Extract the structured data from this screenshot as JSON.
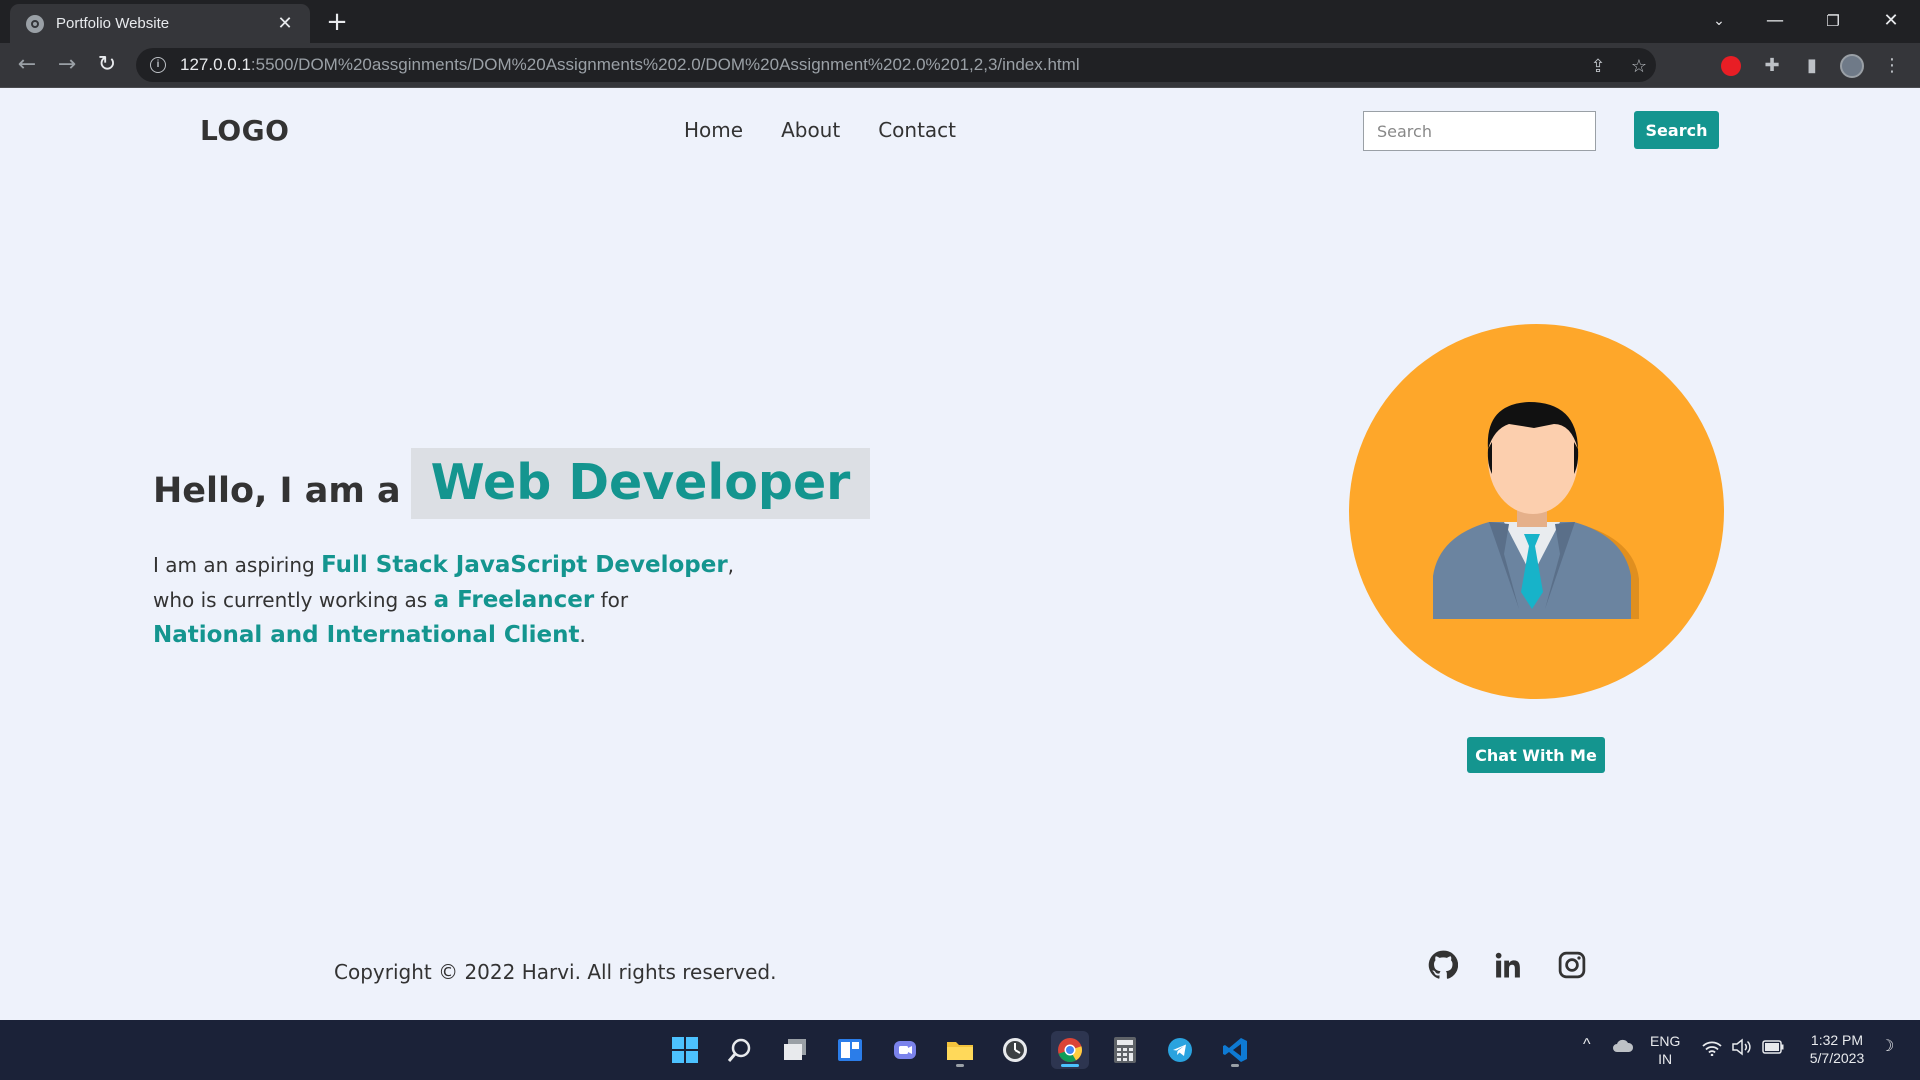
{
  "browser": {
    "tab_title": "Portfolio Website",
    "url_host": "127.0.0.1",
    "url_rest": ":5500/DOM%20assginments/DOM%20Assignments%202.0/DOM%20Assignment%202.0%201,2,3/index.html"
  },
  "header": {
    "logo": "LOGO",
    "nav": [
      {
        "label": "Home"
      },
      {
        "label": "About"
      },
      {
        "label": "Contact"
      }
    ],
    "search_placeholder": "Search",
    "search_button": "Search"
  },
  "hero": {
    "greeting": "Hello, I am a",
    "role": "Web Developer",
    "line1_prefix": "I am an aspiring ",
    "line1_highlight": "Full Stack JavaScript Developer",
    "line1_suffix": ",",
    "line2_prefix": "who is currently working as ",
    "line2_highlight": "a Freelancer",
    "line2_suffix": " for",
    "line3_highlight": "National and International Client",
    "line3_suffix": "."
  },
  "profile": {
    "chat_button": "Chat With Me",
    "circle_color": "#fea72a"
  },
  "footer": {
    "copyright": "Copyright © 2022 Harvi. All rights reserved.",
    "social_icons": [
      "github-icon",
      "linkedin-icon",
      "instagram-icon"
    ]
  },
  "taskbar": {
    "lang_line1": "ENG",
    "lang_line2": "IN",
    "time": "1:32 PM",
    "date": "5/7/2023"
  },
  "colors": {
    "accent": "#14958f",
    "page_bg": "#eef2fb",
    "text": "#333333"
  }
}
